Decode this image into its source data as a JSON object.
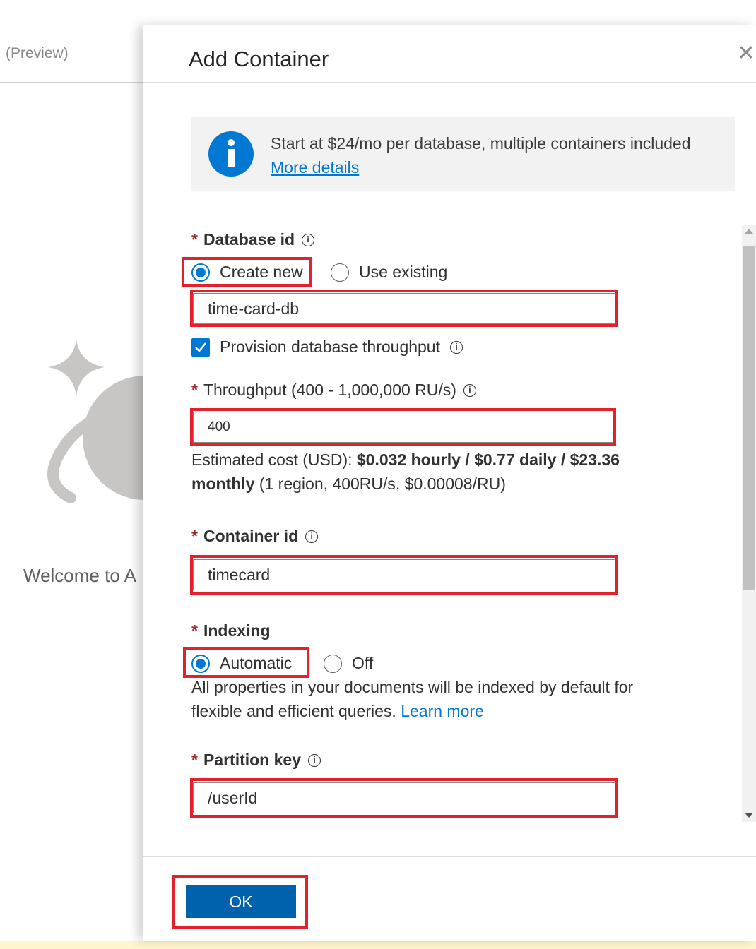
{
  "background": {
    "header_text": "(Preview)",
    "welcome_text": "Welcome to A"
  },
  "panel": {
    "title": "Add Container",
    "close_icon": "close-icon",
    "info": {
      "icon": "info-icon",
      "text": "Start at $24/mo per database, multiple containers included",
      "link": "More details"
    },
    "database_id": {
      "label": "Database id",
      "required": "*",
      "options": [
        "Create new",
        "Use existing"
      ],
      "selected": "Create new",
      "value": "time-card-db"
    },
    "provision_throughput": {
      "label": "Provision database throughput",
      "checked": true
    },
    "throughput": {
      "label": "Throughput (400 - 1,000,000 RU/s)",
      "required": "*",
      "value": "400"
    },
    "estimated_cost": {
      "prefix": "Estimated cost (USD): ",
      "bold": "$0.032 hourly / $0.77 daily / $23.36 monthly",
      "suffix": " (1 region, 400RU/s, $0.00008/RU)"
    },
    "container_id": {
      "label": "Container id",
      "required": "*",
      "value": "timecard"
    },
    "indexing": {
      "label": "Indexing",
      "required": "*",
      "options": [
        "Automatic",
        "Off"
      ],
      "selected": "Automatic",
      "description": "All properties in your documents will be indexed by default for flexible and efficient queries.",
      "link": "Learn more"
    },
    "partition_key": {
      "label": "Partition key",
      "required": "*",
      "value": "/userId"
    },
    "ok_label": "OK"
  },
  "colors": {
    "accent": "#0078d4",
    "ok_button": "#0062ad",
    "highlight": "#e3202c",
    "required": "#a4262c"
  }
}
